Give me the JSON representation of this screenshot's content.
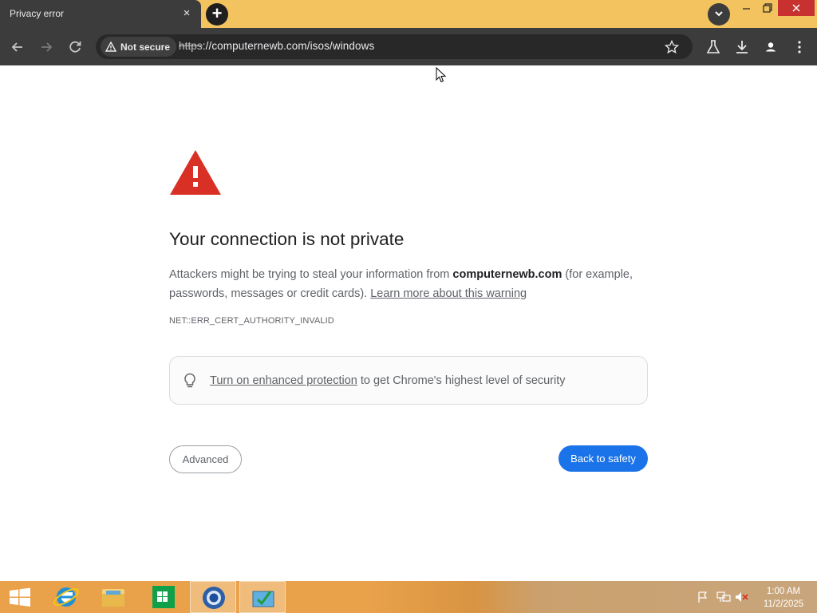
{
  "browser": {
    "tab": {
      "title": "Privacy error",
      "close_label": "×"
    },
    "new_tab_label": "+",
    "toolbar": {
      "security_chip": "Not secure",
      "url_scheme": "https",
      "url_rest": "://computernewb.com/isos/windows"
    }
  },
  "page": {
    "heading": "Your connection is not private",
    "explanation": {
      "lead": "Attackers might be trying to steal your information from ",
      "host": "computernewb.com",
      "tail": " (for example, passwords, messages or credit cards). ",
      "learn_more": "Learn more about this warning"
    },
    "error_code": "NET::ERR_CERT_AUTHORITY_INVALID",
    "enhanced_protection": {
      "link": "Turn on enhanced protection",
      "rest": " to get Chrome's highest level of security"
    },
    "advanced_label": "Advanced",
    "back_to_safety_label": "Back to safety"
  },
  "taskbar": {
    "items": [
      "start-icon",
      "internet-explorer-icon",
      "file-explorer-icon",
      "store-icon",
      "chrome-beta-icon",
      "tasks-icon"
    ],
    "clock": {
      "time": "1:00 AM",
      "date": "11/2/2025"
    }
  },
  "colors": {
    "tab_strip": "#f2c35e",
    "toolbar": "#3c3c3c",
    "primary_button": "#1a73e8",
    "warning_red": "#d93025",
    "taskbar": "#e9a24a"
  }
}
